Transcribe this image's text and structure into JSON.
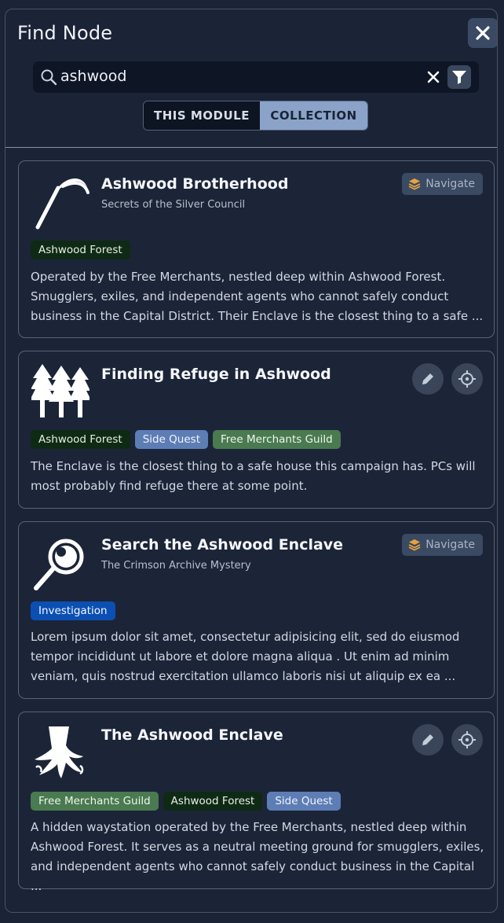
{
  "panel": {
    "title": "Find Node",
    "close_icon": "close-icon"
  },
  "search": {
    "query": "ashwood",
    "search_icon": "search-icon",
    "clear_icon": "clear-icon",
    "filter_icon": "filter-icon"
  },
  "scope_toggle": {
    "options": [
      "THIS MODULE",
      "COLLECTION"
    ],
    "selected": "COLLECTION"
  },
  "results": [
    {
      "title": "Ashwood Brotherhood",
      "subtitle": "Secrets of the Silver Council",
      "icon": "scythe-icon",
      "action": "Navigate",
      "tags": [
        "Ashwood Forest"
      ],
      "description_lines": [
        "Operated by the Free Merchants, nestled deep within Ashwood Forest.",
        "Smugglers, exiles, and independent agents who cannot safely conduct",
        "business in the Capital District. Their Enclave is the closest thing to a safe ..."
      ]
    },
    {
      "title": "Finding Refuge in Ashwood",
      "subtitle": "",
      "icon": "pine-forest-icon",
      "tags": [
        "Ashwood Forest",
        "Side Quest",
        "Free Merchants Guild"
      ],
      "description_lines": [
        "The Enclave is the closest thing to a safe house this campaign has. PCs will",
        "most probably find refuge there at some point."
      ]
    },
    {
      "title": "Search the Ashwood Enclave",
      "subtitle": "The Crimson Archive Mystery",
      "icon": "magnifying-glass-icon",
      "action": "Navigate",
      "tags": [
        "Investigation"
      ],
      "description_lines": [
        "Lorem ipsum dolor sit amet, consectetur adipisicing elit, sed do eiusmod",
        "tempor incididunt ut labore et dolore magna aliqua . Ut enim ad minim",
        "veniam, quis nostrud exercitation ullamco laboris nisi ut aliquip ex ea ..."
      ]
    },
    {
      "title": "The Ashwood Enclave",
      "subtitle": "",
      "icon": "tree-stump-icon",
      "tags": [
        "Free Merchants Guild",
        "Ashwood Forest",
        "Side Quest"
      ],
      "description_lines": [
        "A hidden waystation operated by the Free Merchants, nestled deep within",
        "Ashwood Forest. It serves as a neutral meeting ground for smugglers, exiles,",
        "and independent agents who cannot safely conduct business in the Capital ..."
      ]
    }
  ],
  "colors": {
    "background": "#1b2336",
    "tag_forest": "#0f2a14",
    "tag_quest": "#5d7db5",
    "tag_guild": "#4a7a50",
    "tag_investigation": "#0c4fb3",
    "navigate_icon": "#e8a33c"
  }
}
